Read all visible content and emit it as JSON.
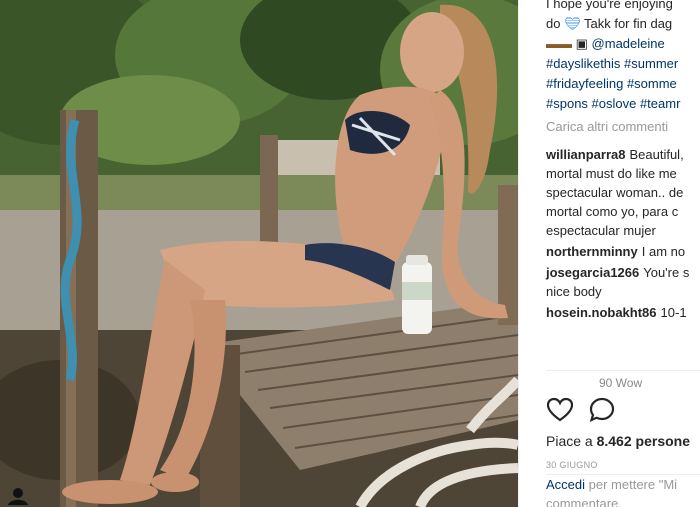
{
  "caption": {
    "line1": "I hope you're enjoying",
    "line2_prefix": "do",
    "line2_suffix": "Takk for fin dag",
    "line3_mention": "@madeleine",
    "line4": "#dayslikethis #summer",
    "line5": "#fridayfeeling #somme",
    "line6": "#spons #oslove #teamr"
  },
  "load_more": "Carica altri commenti",
  "comments": [
    {
      "user": "willianparra8",
      "text": "Beautiful, mortal must do like me spectacular woman.. de mortal como yo, para c espectacular mujer"
    },
    {
      "user": "northernminny",
      "text": "I am no"
    },
    {
      "user": "josegarcia1266",
      "text": "You're s nice body"
    },
    {
      "user": "hosein.nobakht86",
      "text": "10-1"
    }
  ],
  "partial_comment": "90 Wow",
  "likes": {
    "prefix": "Piace a ",
    "count": "8.462",
    "suffix": " persone"
  },
  "date": "30 GIUGNO",
  "login": {
    "link": "Accedi",
    "rest": " per mettere \"Mi",
    "line2": "commentare."
  },
  "icons": {
    "like": "heart-outline-icon",
    "comment": "comment-bubble-icon",
    "corner": "profile-tag-icon"
  },
  "colors": {
    "link": "#003569",
    "heart": "#3897f0",
    "muted": "#999999"
  }
}
